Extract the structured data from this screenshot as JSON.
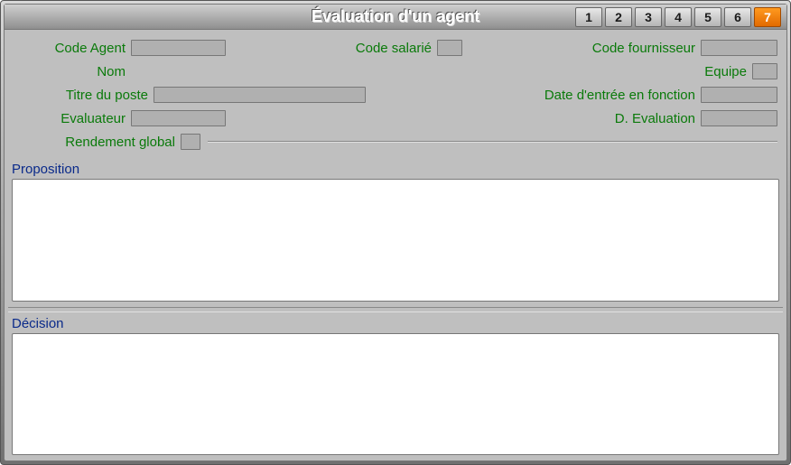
{
  "title": "Évaluation d'un agent",
  "tabs": [
    {
      "label": "1",
      "active": false
    },
    {
      "label": "2",
      "active": false
    },
    {
      "label": "3",
      "active": false
    },
    {
      "label": "4",
      "active": false
    },
    {
      "label": "5",
      "active": false
    },
    {
      "label": "6",
      "active": false
    },
    {
      "label": "7",
      "active": true
    }
  ],
  "labels": {
    "code_agent": "Code Agent",
    "code_salarie": "Code salarié",
    "code_fournisseur": "Code fournisseur",
    "nom": "Nom",
    "equipe": "Equipe",
    "titre_poste": "Titre du poste",
    "date_entree": "Date d'entrée en fonction",
    "evaluateur": "Evaluateur",
    "d_evaluation": "D. Evaluation",
    "rendement_global": "Rendement global"
  },
  "fields": {
    "code_agent": "",
    "code_salarie": "",
    "code_fournisseur": "",
    "nom": "",
    "equipe": "",
    "titre_poste": "",
    "date_entree": "",
    "evaluateur": "",
    "d_evaluation": "",
    "rendement_global": ""
  },
  "sections": {
    "proposition": {
      "label": "Proposition",
      "value": ""
    },
    "decision": {
      "label": "Décision",
      "value": ""
    }
  }
}
